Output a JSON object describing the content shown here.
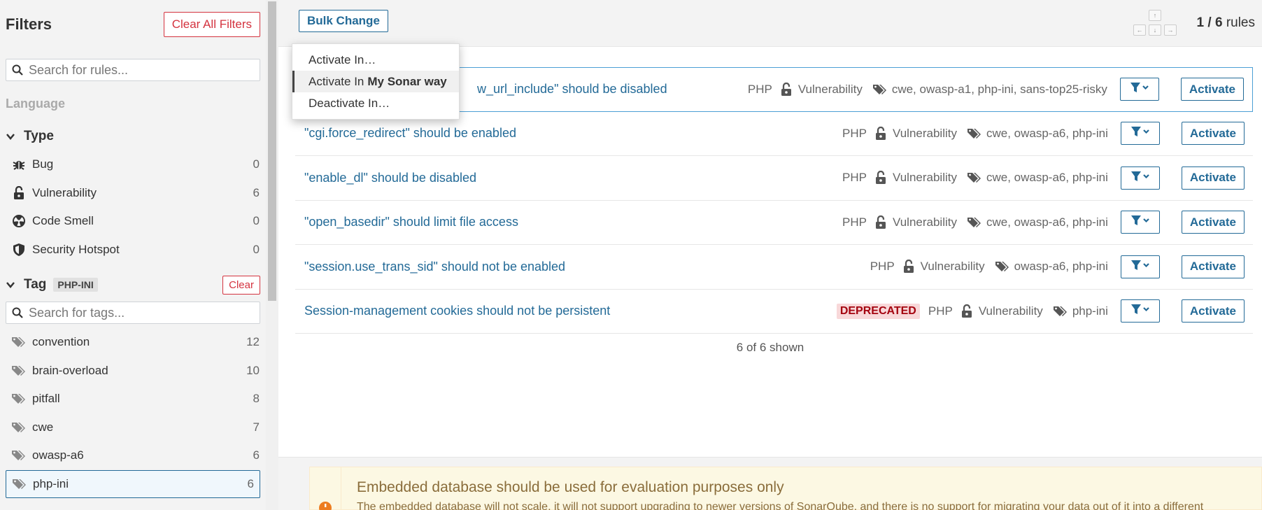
{
  "sidebar": {
    "title": "Filters",
    "clear_all_label": "Clear All Filters",
    "search_placeholder": "Search for rules...",
    "language_label": "Language",
    "type_facet": {
      "label": "Type",
      "items": [
        {
          "label": "Bug",
          "count": "0",
          "icon": "bug-icon"
        },
        {
          "label": "Vulnerability",
          "count": "6",
          "icon": "lock-open-icon"
        },
        {
          "label": "Code Smell",
          "count": "0",
          "icon": "code-smell-icon"
        },
        {
          "label": "Security Hotspot",
          "count": "0",
          "icon": "shield-icon"
        }
      ]
    },
    "tag_facet": {
      "label": "Tag",
      "selected_badge": "PHP-INI",
      "clear_label": "Clear",
      "search_placeholder": "Search for tags...",
      "items": [
        {
          "label": "convention",
          "count": "12"
        },
        {
          "label": "brain-overload",
          "count": "10"
        },
        {
          "label": "pitfall",
          "count": "8"
        },
        {
          "label": "cwe",
          "count": "7"
        },
        {
          "label": "owasp-a6",
          "count": "6"
        },
        {
          "label": "php-ini",
          "count": "6",
          "active": true
        }
      ]
    }
  },
  "toolbar": {
    "bulk_change_label": "Bulk Change",
    "count_current": "1",
    "count_total": "6",
    "count_suffix": "rules",
    "kbd_up": "↑",
    "kbd_left": "←",
    "kbd_down": "↓",
    "kbd_right": "→"
  },
  "bulk_menu": {
    "items": [
      {
        "label": "Activate In…"
      },
      {
        "label": "Activate In",
        "bold": "My Sonar way",
        "selected": true
      },
      {
        "label": "Deactivate In…"
      }
    ]
  },
  "rules": [
    {
      "name": "\"allow_url_include\" should be disabled",
      "visible_name": "w_url_include\" should be disabled",
      "lang": "PHP",
      "type": "Vulnerability",
      "tags": "cwe, owasp-a1, php-ini, sans-top25-risky",
      "deprecated": "",
      "activate_label": "Activate"
    },
    {
      "name": "\"cgi.force_redirect\" should be enabled",
      "lang": "PHP",
      "type": "Vulnerability",
      "tags": "cwe, owasp-a6, php-ini",
      "deprecated": "",
      "activate_label": "Activate"
    },
    {
      "name": "\"enable_dl\" should be disabled",
      "lang": "PHP",
      "type": "Vulnerability",
      "tags": "cwe, owasp-a6, php-ini",
      "deprecated": "",
      "activate_label": "Activate"
    },
    {
      "name": "\"open_basedir\" should limit file access",
      "lang": "PHP",
      "type": "Vulnerability",
      "tags": "cwe, owasp-a6, php-ini",
      "deprecated": "",
      "activate_label": "Activate"
    },
    {
      "name": "\"session.use_trans_sid\" should not be enabled",
      "lang": "PHP",
      "type": "Vulnerability",
      "tags": "owasp-a6, php-ini",
      "deprecated": "",
      "activate_label": "Activate"
    },
    {
      "name": "Session-management cookies should not be persistent",
      "lang": "PHP",
      "type": "Vulnerability",
      "tags": "php-ini",
      "deprecated": "DEPRECATED",
      "activate_label": "Activate"
    }
  ],
  "shown_text": "6 of 6 shown",
  "warning": {
    "title": "Embedded database should be used for evaluation purposes only",
    "text": "The embedded database will not scale, it will not support upgrading to newer versions of SonarQube, and there is no support for migrating your data out of it into a different"
  },
  "colors": {
    "link_blue": "#236a97",
    "danger_red": "#d4333f",
    "warning_orange": "#ed7d20"
  }
}
